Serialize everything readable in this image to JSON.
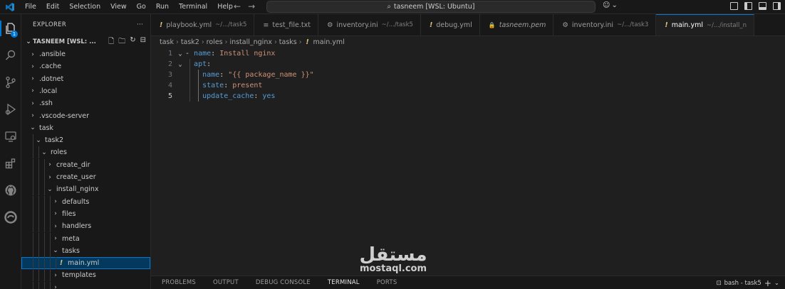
{
  "window": {
    "menu": [
      "File",
      "Edit",
      "Selection",
      "View",
      "Go",
      "Run",
      "Terminal",
      "Help"
    ],
    "command_center": "tasneem [WSL: Ubuntu]"
  },
  "activity_bar": {
    "items": [
      "explorer-icon",
      "search-icon",
      "source-control-icon",
      "run-debug-icon",
      "remote-explorer-icon",
      "extensions-icon",
      "github-icon",
      "edge-icon"
    ],
    "explorer_badge": "1"
  },
  "sidebar": {
    "title": "EXPLORER",
    "more": "···",
    "root_label": "TASNEEM [WSL: ...",
    "tree": [
      {
        "label": ".ansible",
        "depth": 0,
        "type": "folder",
        "expanded": false
      },
      {
        "label": ".cache",
        "depth": 0,
        "type": "folder",
        "expanded": false
      },
      {
        "label": ".dotnet",
        "depth": 0,
        "type": "folder",
        "expanded": false
      },
      {
        "label": ".local",
        "depth": 0,
        "type": "folder",
        "expanded": false
      },
      {
        "label": ".ssh",
        "depth": 0,
        "type": "folder",
        "expanded": false
      },
      {
        "label": ".vscode-server",
        "depth": 0,
        "type": "folder",
        "expanded": false
      },
      {
        "label": "task",
        "depth": 0,
        "type": "folder",
        "expanded": true
      },
      {
        "label": "task2",
        "depth": 1,
        "type": "folder",
        "expanded": true
      },
      {
        "label": "roles",
        "depth": 2,
        "type": "folder",
        "expanded": true
      },
      {
        "label": "create_dir",
        "depth": 3,
        "type": "folder",
        "expanded": false
      },
      {
        "label": "create_user",
        "depth": 3,
        "type": "folder",
        "expanded": false
      },
      {
        "label": "install_nginx",
        "depth": 3,
        "type": "folder",
        "expanded": true
      },
      {
        "label": "defaults",
        "depth": 4,
        "type": "folder",
        "expanded": false
      },
      {
        "label": "files",
        "depth": 4,
        "type": "folder",
        "expanded": false
      },
      {
        "label": "handlers",
        "depth": 4,
        "type": "folder",
        "expanded": false
      },
      {
        "label": "meta",
        "depth": 4,
        "type": "folder",
        "expanded": false
      },
      {
        "label": "tasks",
        "depth": 4,
        "type": "folder",
        "expanded": true
      },
      {
        "label": "main.yml",
        "depth": 5,
        "type": "yml",
        "selected": true
      },
      {
        "label": "templates",
        "depth": 4,
        "type": "folder",
        "expanded": false
      },
      {
        "label": "",
        "depth": 4,
        "type": "folder",
        "expanded": false
      }
    ]
  },
  "tabs": [
    {
      "label": "playbook.yml",
      "desc": "~/.../task5",
      "icon": "!",
      "kind": "yml"
    },
    {
      "label": "test_file.txt",
      "desc": "",
      "icon": "≡",
      "kind": "txt"
    },
    {
      "label": "inventory.ini",
      "desc": "~/.../task5",
      "icon": "⚙",
      "kind": "ini"
    },
    {
      "label": "debug.yml",
      "desc": "",
      "icon": "!",
      "kind": "yml"
    },
    {
      "label": "tasneem.pem",
      "desc": "",
      "icon": "🔒",
      "kind": "pem"
    },
    {
      "label": "inventory.ini",
      "desc": "~/.../task3",
      "icon": "⚙",
      "kind": "ini"
    },
    {
      "label": "main.yml",
      "desc": "~/.../install_n",
      "icon": "!",
      "kind": "yml",
      "active": true
    }
  ],
  "breadcrumb": [
    "task",
    "task2",
    "roles",
    "install_nginx",
    "tasks",
    "main.yml"
  ],
  "editor": {
    "lines": [
      {
        "num": "1",
        "fold": "⌄",
        "segments": [
          {
            "t": "- ",
            "c": "p"
          },
          {
            "t": "name",
            "c": "k"
          },
          {
            "t": ": ",
            "c": "p"
          },
          {
            "t": "Install nginx",
            "c": "v"
          }
        ]
      },
      {
        "num": "2",
        "fold": "⌄",
        "segments": [
          {
            "t": "  ",
            "c": "p"
          },
          {
            "t": "apt",
            "c": "k"
          },
          {
            "t": ":",
            "c": "p"
          }
        ]
      },
      {
        "num": "3",
        "fold": "",
        "segments": [
          {
            "t": "    ",
            "c": "p"
          },
          {
            "t": "name",
            "c": "k"
          },
          {
            "t": ": ",
            "c": "p"
          },
          {
            "t": "\"{{ package_name }}\"",
            "c": "v"
          }
        ]
      },
      {
        "num": "4",
        "fold": "",
        "segments": [
          {
            "t": "    ",
            "c": "p"
          },
          {
            "t": "state",
            "c": "k"
          },
          {
            "t": ": ",
            "c": "p"
          },
          {
            "t": "present",
            "c": "v"
          }
        ]
      },
      {
        "num": "5",
        "fold": "",
        "current": true,
        "segments": [
          {
            "t": "    ",
            "c": "p"
          },
          {
            "t": "update_cache",
            "c": "k"
          },
          {
            "t": ": ",
            "c": "p"
          },
          {
            "t": "yes",
            "c": "bool"
          }
        ]
      }
    ]
  },
  "panel": {
    "tabs": [
      "PROBLEMS",
      "OUTPUT",
      "DEBUG CONSOLE",
      "TERMINAL",
      "PORTS"
    ],
    "active_tab": "TERMINAL",
    "terminal_name": "bash - task5",
    "add_terminal": "+",
    "dropdown": "⌄"
  },
  "watermark": {
    "arabic": "مستقل",
    "latin": "mostaql.com"
  }
}
